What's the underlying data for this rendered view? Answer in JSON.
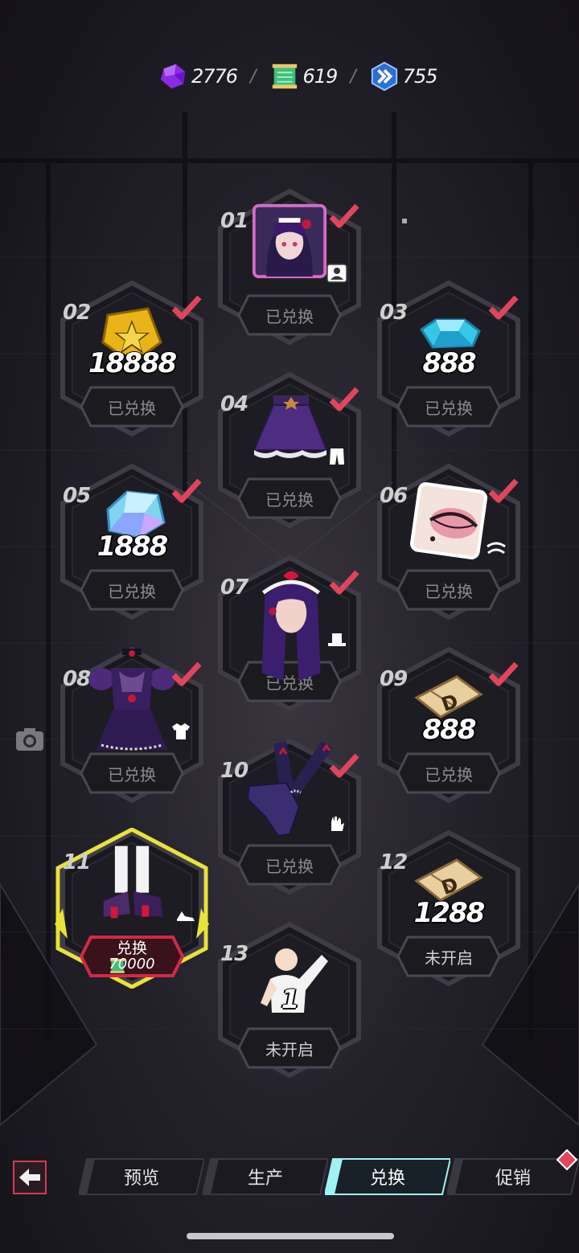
{
  "currencies": [
    {
      "name": "purple-crystal",
      "value": "2776"
    },
    {
      "name": "green-scroll",
      "value": "619"
    },
    {
      "name": "blue-chevron-token",
      "value": "755"
    }
  ],
  "currency_separator": "/",
  "nodes": [
    {
      "num": "01",
      "item": "character-portrait",
      "badge": "person-badge-icon",
      "redeemed": true,
      "button": "已兑换"
    },
    {
      "num": "02",
      "item": "gold-star-badge",
      "amount": "18888",
      "redeemed": true,
      "button": "已兑换"
    },
    {
      "num": "03",
      "item": "blue-gem",
      "amount": "888",
      "redeemed": true,
      "button": "已兑换"
    },
    {
      "num": "04",
      "item": "purple-skirt",
      "badge": "pants-badge-icon",
      "redeemed": true,
      "button": "已兑换"
    },
    {
      "num": "05",
      "item": "holo-crystal",
      "amount": "1888",
      "redeemed": true,
      "button": "已兑换"
    },
    {
      "num": "06",
      "item": "eye-makeup-card",
      "badge": "eyebrow-badge-icon",
      "redeemed": true,
      "button": "已兑换"
    },
    {
      "num": "07",
      "item": "hairstyle",
      "badge": "hat-badge-icon",
      "redeemed": true,
      "button": "已兑换"
    },
    {
      "num": "08",
      "item": "dress-top",
      "badge": "shirt-badge-icon",
      "redeemed": true,
      "button": "已兑换"
    },
    {
      "num": "09",
      "item": "d-ticket",
      "amount": "888",
      "redeemed": true,
      "button": "已兑换"
    },
    {
      "num": "10",
      "item": "gloves",
      "badge": "glove-badge-icon",
      "redeemed": true,
      "button": "已兑换"
    },
    {
      "num": "11",
      "item": "shoes",
      "badge": "shoe-badge-icon",
      "redeemed": false,
      "button": "兑换",
      "cost": "70000"
    },
    {
      "num": "12",
      "item": "d-ticket",
      "amount": "1288",
      "redeemed": false,
      "button": "未开启"
    },
    {
      "num": "13",
      "item": "pose",
      "amount": "1",
      "redeemed": false,
      "button": "未开启"
    }
  ],
  "tabs": [
    {
      "label": "预览",
      "active": false
    },
    {
      "label": "生产",
      "active": false
    },
    {
      "label": "兑换",
      "active": true
    },
    {
      "label": "促销",
      "active": false
    }
  ],
  "colors": {
    "check_red": "#e0455e",
    "selected_yellow": "#e8e23a",
    "active_button_red": "#c8283f",
    "tab_active_cyan": "#9ff2f0"
  }
}
